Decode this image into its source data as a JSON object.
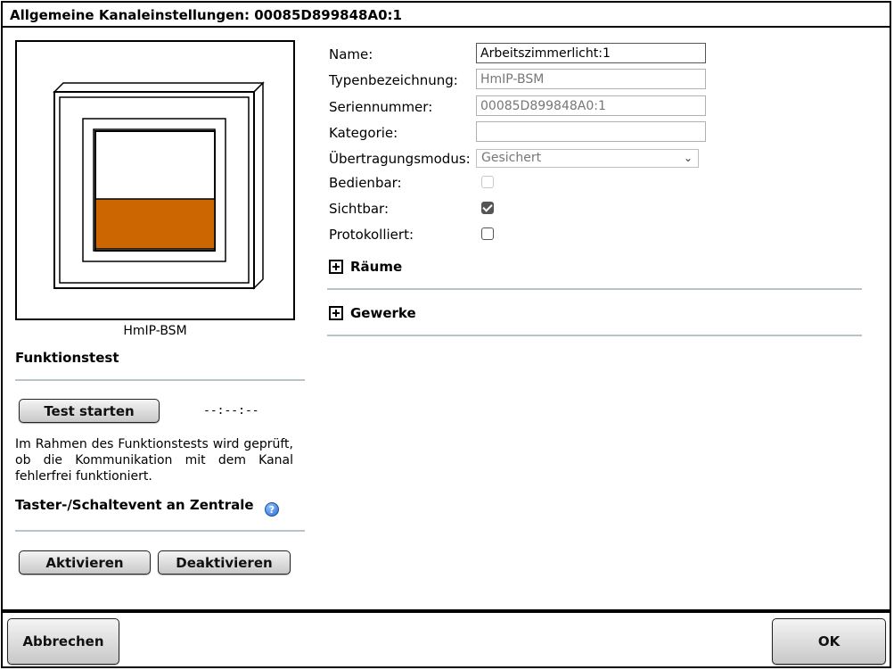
{
  "dialog": {
    "title": "Allgemeine Kanaleinstellungen: 00085D899848A0:1"
  },
  "device": {
    "image_icon": "hmip-bsm-switch-illustration",
    "label": "HmIP-BSM",
    "fill_color": "#cc6600"
  },
  "function_test": {
    "title": "Funktionstest",
    "start_button": "Test starten",
    "time": "--:--:--",
    "description": "Im Rahmen des Funktionstests wird geprüft, ob die Kommunikation mit dem Kanal fehlerfrei funktioniert."
  },
  "event": {
    "title": "Taster-/Schaltevent an Zentrale",
    "help_icon": "help-icon",
    "activate_button": "Aktivieren",
    "deactivate_button": "Deaktivieren"
  },
  "form": {
    "name_label": "Name:",
    "name_value": "Arbeitszimmerlicht:1",
    "type_label": "Typenbezeichnung:",
    "type_value": "HmIP-BSM",
    "serial_label": "Seriennummer:",
    "serial_value": "00085D899848A0:1",
    "category_label": "Kategorie:",
    "category_value": "",
    "mode_label": "Übertragungsmodus:",
    "mode_value": "Gesichert",
    "operable_label": "Bedienbar:",
    "operable_checked": false,
    "visible_label": "Sichtbar:",
    "visible_checked": true,
    "logged_label": "Protokolliert:",
    "logged_checked": false
  },
  "sections": {
    "rooms": "Räume",
    "trades": "Gewerke"
  },
  "footer": {
    "cancel_button": "Abbrechen",
    "ok_button": "OK"
  }
}
